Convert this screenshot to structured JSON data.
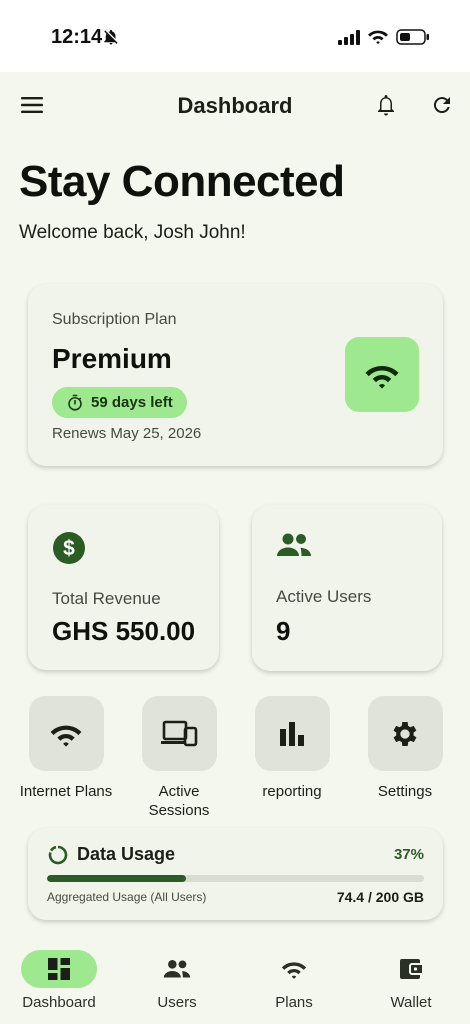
{
  "status": {
    "time": "12:14"
  },
  "app_bar": {
    "title": "Dashboard"
  },
  "hero": {
    "title": "Stay Connected",
    "welcome": "Welcome back, Josh John!"
  },
  "subscription": {
    "label": "Subscription Plan",
    "plan": "Premium",
    "days_left": "59 days left",
    "renews": "Renews May 25, 2026"
  },
  "stats": {
    "revenue": {
      "label": "Total Revenue",
      "value": "GHS 550.00"
    },
    "users": {
      "label": "Active Users",
      "value": "9"
    }
  },
  "quick_actions": [
    {
      "label": "Internet Plans",
      "icon": "wifi-icon"
    },
    {
      "label": "Active Sessions",
      "icon": "devices-icon"
    },
    {
      "label": "reporting",
      "icon": "bar-chart-icon"
    },
    {
      "label": "Settings",
      "icon": "gear-icon"
    }
  ],
  "usage": {
    "title": "Data Usage",
    "percent_label": "37%",
    "percent": 37,
    "subtitle": "Aggregated Usage (All Users)",
    "amount": "74.4 / 200 GB"
  },
  "nav": [
    {
      "label": "Dashboard",
      "icon": "dashboard-icon",
      "active": true
    },
    {
      "label": "Users",
      "icon": "people-icon",
      "active": false
    },
    {
      "label": "Plans",
      "icon": "wifi-icon",
      "active": false
    },
    {
      "label": "Wallet",
      "icon": "wallet-icon",
      "active": false
    }
  ],
  "colors": {
    "background": "#f4f7ee",
    "accent": "#9ee88f",
    "primary_dark": "#2c5c25",
    "card": "#f1f4ea"
  }
}
